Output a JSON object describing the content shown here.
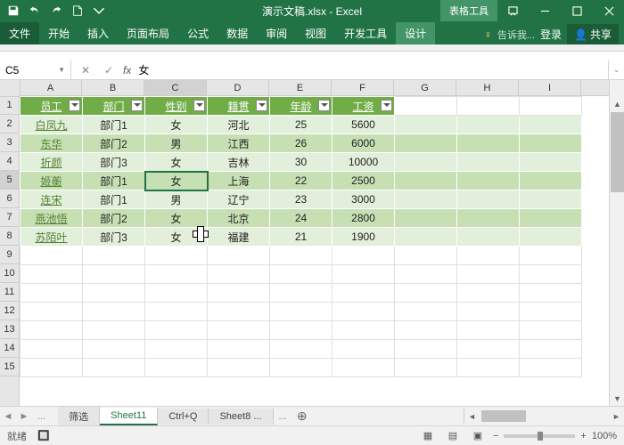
{
  "titlebar": {
    "doc_title": "演示文稿.xlsx - Excel",
    "table_tools": "表格工具"
  },
  "ribbon": {
    "file": "文件",
    "tabs": [
      "开始",
      "插入",
      "页面布局",
      "公式",
      "数据",
      "审阅",
      "视图",
      "开发工具"
    ],
    "design": "设计",
    "tell_me": "告诉我...",
    "login": "登录",
    "share": "共享"
  },
  "formula_bar": {
    "name_box": "C5",
    "fx": "fx",
    "value": "女"
  },
  "columns": [
    "A",
    "B",
    "C",
    "D",
    "E",
    "F",
    "G",
    "H",
    "I"
  ],
  "rows": [
    "1",
    "2",
    "3",
    "4",
    "5",
    "6",
    "7",
    "8",
    "9",
    "10",
    "11",
    "12",
    "13",
    "14",
    "15"
  ],
  "table": {
    "headers": [
      "员工",
      "部门",
      "性别",
      "籍贯",
      "年龄",
      "工资"
    ],
    "data": [
      [
        "白凤九",
        "部门1",
        "女",
        "河北",
        "25",
        "5600"
      ],
      [
        "东华",
        "部门2",
        "男",
        "江西",
        "26",
        "6000"
      ],
      [
        "折颜",
        "部门3",
        "女",
        "吉林",
        "30",
        "10000"
      ],
      [
        "姬蘅",
        "部门1",
        "女",
        "上海",
        "22",
        "2500"
      ],
      [
        "连宋",
        "部门1",
        "男",
        "辽宁",
        "23",
        "3000"
      ],
      [
        "燕池悟",
        "部门2",
        "女",
        "北京",
        "24",
        "2800"
      ],
      [
        "苏陌叶",
        "部门3",
        "女",
        "福建",
        "21",
        "1900"
      ]
    ]
  },
  "sheets": {
    "items": [
      "筛选",
      "Sheet11",
      "Ctrl+Q",
      "Sheet8 ..."
    ],
    "active": 1
  },
  "status": {
    "ready": "就绪",
    "scroll_lock_icon": "⎵",
    "zoom": "100%",
    "minus": "−",
    "plus": "+"
  }
}
